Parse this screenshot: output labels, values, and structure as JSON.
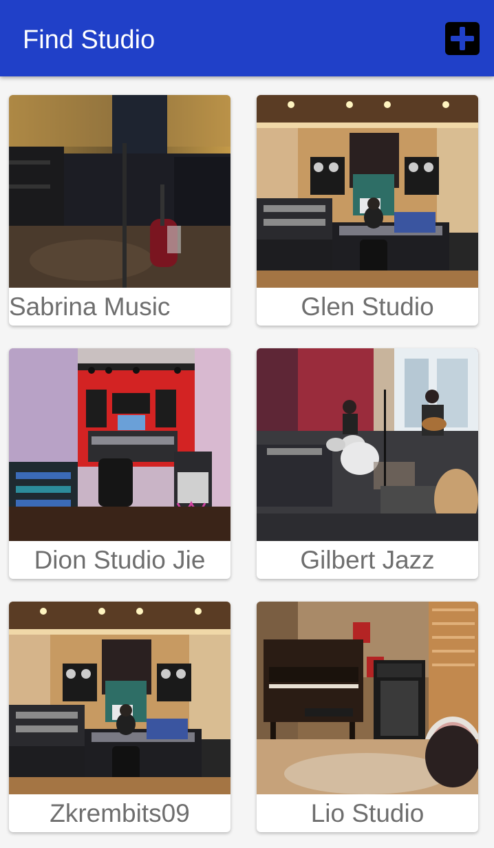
{
  "app_bar": {
    "title": "Find Studio",
    "add_button_icon": "plus-icon",
    "colors": {
      "background": "#2040c8",
      "title": "#ffffff"
    }
  },
  "studios": [
    {
      "name": "Sabrina Music",
      "image": "dark studio room with amplifiers and electric guitar"
    },
    {
      "name": "Glen Studio",
      "image": "control room with mixing console, monitors and producer"
    },
    {
      "name": "Dion Studio Jie",
      "image": "red-walled control room with mixing desk and racks"
    },
    {
      "name": "Gilbert Jazz",
      "image": "live room with drum kit and guitarist"
    },
    {
      "name": "Zkrembits09",
      "image": "control room with mixing console, monitors and producer"
    },
    {
      "name": "Lio Studio",
      "image": "wood-panelled room with upright piano, amp and drum"
    }
  ],
  "colors": {
    "label_text": "#6e6e6e",
    "card_background": "#ffffff",
    "page_background": "#f5f5f5"
  }
}
